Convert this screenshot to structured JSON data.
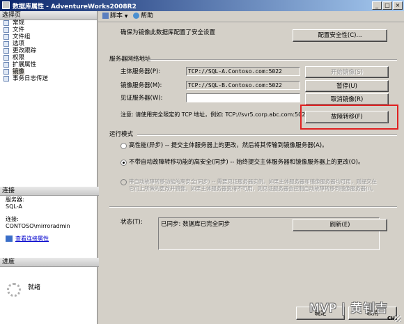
{
  "window": {
    "title": "数据库属性 - AdventureWorks2008R2"
  },
  "titlebar_buttons": {
    "minimize": "_",
    "maximize": "□",
    "close": "×"
  },
  "left_panel": {
    "select_page_label": "选择页",
    "pages": [
      {
        "label": "常规",
        "selected": false
      },
      {
        "label": "文件",
        "selected": false
      },
      {
        "label": "文件组",
        "selected": false
      },
      {
        "label": "选项",
        "selected": false
      },
      {
        "label": "更改跟踪",
        "selected": false
      },
      {
        "label": "权限",
        "selected": false
      },
      {
        "label": "扩展属性",
        "selected": false
      },
      {
        "label": "镜像",
        "selected": true
      },
      {
        "label": "事务日志传送",
        "selected": false
      }
    ],
    "connection_label": "连接",
    "server_label": "服务器:",
    "server_value": "SQL-A",
    "connection_field_label": "连接:",
    "connection_value": "CONTOSO\\mirroradmin",
    "view_connection_props": "查看连接属性",
    "progress_label": "进度",
    "progress_status": "就绪"
  },
  "toolbar": {
    "script_label": "脚本",
    "help_label": "帮助",
    "dropdown_arrow": "▼"
  },
  "mirroring": {
    "security_description": "确保为镜像此数据库配置了安全设置",
    "configure_security_button": "配置安全性(C)...",
    "network_address_group": "服务器网络地址",
    "principal_label": "主体服务器(P):",
    "principal_value": "TCP://SQL-A.Contoso.com:5022",
    "mirror_label": "镜像服务器(M):",
    "mirror_value": "TCP://SQL-B.Contoso.com:5022",
    "witness_label": "见证服务器(W):",
    "witness_value": "",
    "start_mirroring_button": "开始镜像(S)",
    "pause_button": "暂停(U)",
    "remove_mirroring_button": "取消镜像(R)",
    "failover_button": "故障转移(F)",
    "note_text": "注意: 请使用完全限定的 TCP 地址，例如: TCP://svr5.corp.abc.com:5022",
    "operating_mode_group": "运行模式",
    "modes": [
      {
        "label": "高性能(异步) -- 提交主体服务器上的更改，然后将其传输到镜像服务器(A)。",
        "checked": false,
        "disabled": false
      },
      {
        "label": "不带自动故障转移功能的高安全(同步) -- 始终提交主体服务器和镜像服务器上的更改(O)。",
        "checked": true,
        "disabled": false
      },
      {
        "label_line1": "带自动故障转移功能的高安全(同步) -- 需要见证服务器实例。如果主体服务器和镜像服务器均可用，则提交在",
        "label_line2": "它们上所做的更改并镜像。如果主体服务器变得不可用，则见证服务器会控制自动故障转移到镜像服务器(I)。",
        "checked": false,
        "disabled": true
      }
    ],
    "status_label": "状态(T):",
    "status_value": "已同步: 数据库已完全同步",
    "refresh_button": "刷新(E)",
    "ok_button": "确定",
    "cancel_button": "取消"
  },
  "watermark": "MVP | 黄钊吉",
  "lang_indicator": "CH",
  "colors": {
    "title_start": "#0a246a",
    "title_end": "#a6caf0",
    "highlight": "#e02020",
    "dialog_bg": "#d4d0c8"
  }
}
